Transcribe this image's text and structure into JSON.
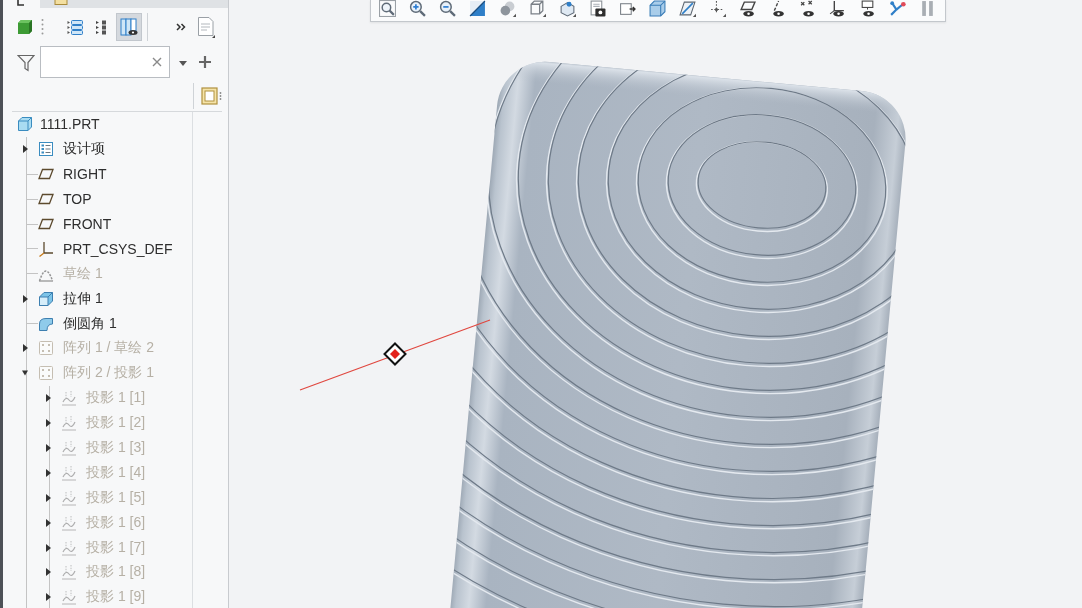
{
  "panel_tabs": [
    {
      "kind": "tree",
      "selected": true
    },
    {
      "kind": "folder",
      "selected": false
    }
  ],
  "tree_tools": [
    {
      "kind": "tree",
      "selected": false
    },
    {
      "kind": "dots",
      "selected": false
    },
    {
      "kind": "columns",
      "selected": true
    }
  ],
  "tree": {
    "root": {
      "label": "1111.PRT",
      "kind": "part",
      "children": [
        {
          "label": "设计项",
          "kind": "items",
          "has_children": true,
          "expanded": false,
          "dimmed": false
        },
        {
          "label": "RIGHT",
          "kind": "plane",
          "has_children": false,
          "expanded": false,
          "dimmed": false
        },
        {
          "label": "TOP",
          "kind": "plane",
          "has_children": false,
          "expanded": false,
          "dimmed": false
        },
        {
          "label": "FRONT",
          "kind": "plane",
          "has_children": false,
          "expanded": false,
          "dimmed": false
        },
        {
          "label": "PRT_CSYS_DEF",
          "kind": "csys",
          "has_children": false,
          "expanded": false,
          "dimmed": false
        },
        {
          "label": "草绘 1",
          "kind": "sketch",
          "has_children": false,
          "expanded": false,
          "dimmed": true
        },
        {
          "label": "拉伸 1",
          "kind": "extrude",
          "has_children": true,
          "expanded": false,
          "dimmed": false
        },
        {
          "label": "倒圆角 1",
          "kind": "round",
          "has_children": false,
          "expanded": false,
          "dimmed": false
        },
        {
          "label": "阵列 1 / 草绘 2",
          "kind": "pattern",
          "has_children": true,
          "expanded": false,
          "dimmed": true
        },
        {
          "label": "阵列 2 / 投影 1",
          "kind": "pattern",
          "has_children": true,
          "expanded": true,
          "dimmed": true,
          "children": [
            {
              "label": "投影 1 [1]",
              "kind": "projection",
              "has_children": true,
              "expanded": false,
              "dimmed": true
            },
            {
              "label": "投影 1 [2]",
              "kind": "projection",
              "has_children": true,
              "expanded": false,
              "dimmed": true
            },
            {
              "label": "投影 1 [3]",
              "kind": "projection",
              "has_children": true,
              "expanded": false,
              "dimmed": true
            },
            {
              "label": "投影 1 [4]",
              "kind": "projection",
              "has_children": true,
              "expanded": false,
              "dimmed": true
            },
            {
              "label": "投影 1 [5]",
              "kind": "projection",
              "has_children": true,
              "expanded": false,
              "dimmed": true
            },
            {
              "label": "投影 1 [6]",
              "kind": "projection",
              "has_children": true,
              "expanded": false,
              "dimmed": true
            },
            {
              "label": "投影 1 [7]",
              "kind": "projection",
              "has_children": true,
              "expanded": false,
              "dimmed": true
            },
            {
              "label": "投影 1 [8]",
              "kind": "projection",
              "has_children": true,
              "expanded": false,
              "dimmed": true
            },
            {
              "label": "投影 1 [9]",
              "kind": "projection",
              "has_children": true,
              "expanded": false,
              "dimmed": true
            }
          ]
        }
      ]
    }
  }
}
